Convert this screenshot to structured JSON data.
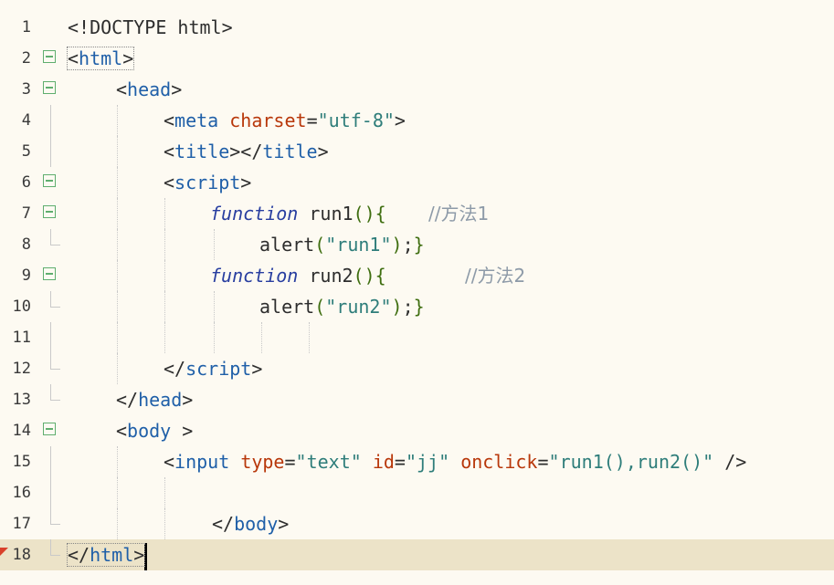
{
  "editor": {
    "line_numbers": [
      "1",
      "2",
      "3",
      "4",
      "5",
      "6",
      "7",
      "8",
      "9",
      "10",
      "11",
      "12",
      "13",
      "14",
      "15",
      "16",
      "17",
      "18"
    ],
    "current_line": "18",
    "lines": {
      "l1": {
        "doctype": "<!DOCTYPE html>"
      },
      "l2": {
        "open": "<",
        "tag": "html",
        "close": ">"
      },
      "l3": {
        "open": "<",
        "tag": "head",
        "close": ">"
      },
      "l4": {
        "open": "<",
        "tag": "meta",
        "attr": "charset",
        "eq": "=",
        "value": "\"utf-8\"",
        "close": ">"
      },
      "l5": {
        "open": "<",
        "tag": "title",
        "mid": "></",
        "tag2": "title",
        "close": ">"
      },
      "l6": {
        "open": "<",
        "tag": "script",
        "close": ">"
      },
      "l7": {
        "keyword": "function",
        "name": " run1",
        "parens": "()",
        "brace": "{",
        "comment": "//方法1"
      },
      "l8": {
        "call": "alert",
        "lparen": "(",
        "str": "\"run1\"",
        "rparen": ")",
        "semi": ";",
        "brace": "}"
      },
      "l9": {
        "keyword": "function",
        "name": " run2",
        "parens": "()",
        "brace": "{",
        "comment": "//方法2"
      },
      "l10": {
        "call": "alert",
        "lparen": "(",
        "str": "\"run2\"",
        "rparen": ")",
        "semi": ";",
        "brace": "}"
      },
      "l12": {
        "open": "</",
        "tag": "script",
        "close": ">"
      },
      "l13": {
        "open": "</",
        "tag": "head",
        "close": ">"
      },
      "l14": {
        "open": "<",
        "tag": "body",
        "close": " >"
      },
      "l15": {
        "open": "<",
        "tag": "input",
        "attr1": "type",
        "val1": "\"text\"",
        "attr2": "id",
        "val2": "\"jj\"",
        "attr3": "onclick",
        "val3": "\"run1(),run2()\"",
        "eq": "=",
        "close": " />"
      },
      "l17": {
        "open": "</",
        "tag": "body",
        "close": ">"
      },
      "l18": {
        "open": "</",
        "tag": "html",
        "close": ">"
      }
    }
  },
  "colors": {
    "background": "#fdfaf2",
    "current_line": "#ece3c8",
    "tag": "#1f5fa8",
    "attribute": "#b8370a",
    "string": "#2e7d7a",
    "keyword": "#283ea0",
    "comment": "#8d9aa8",
    "fold_marker": "#5fae6e",
    "bookmark": "#d9412b"
  }
}
